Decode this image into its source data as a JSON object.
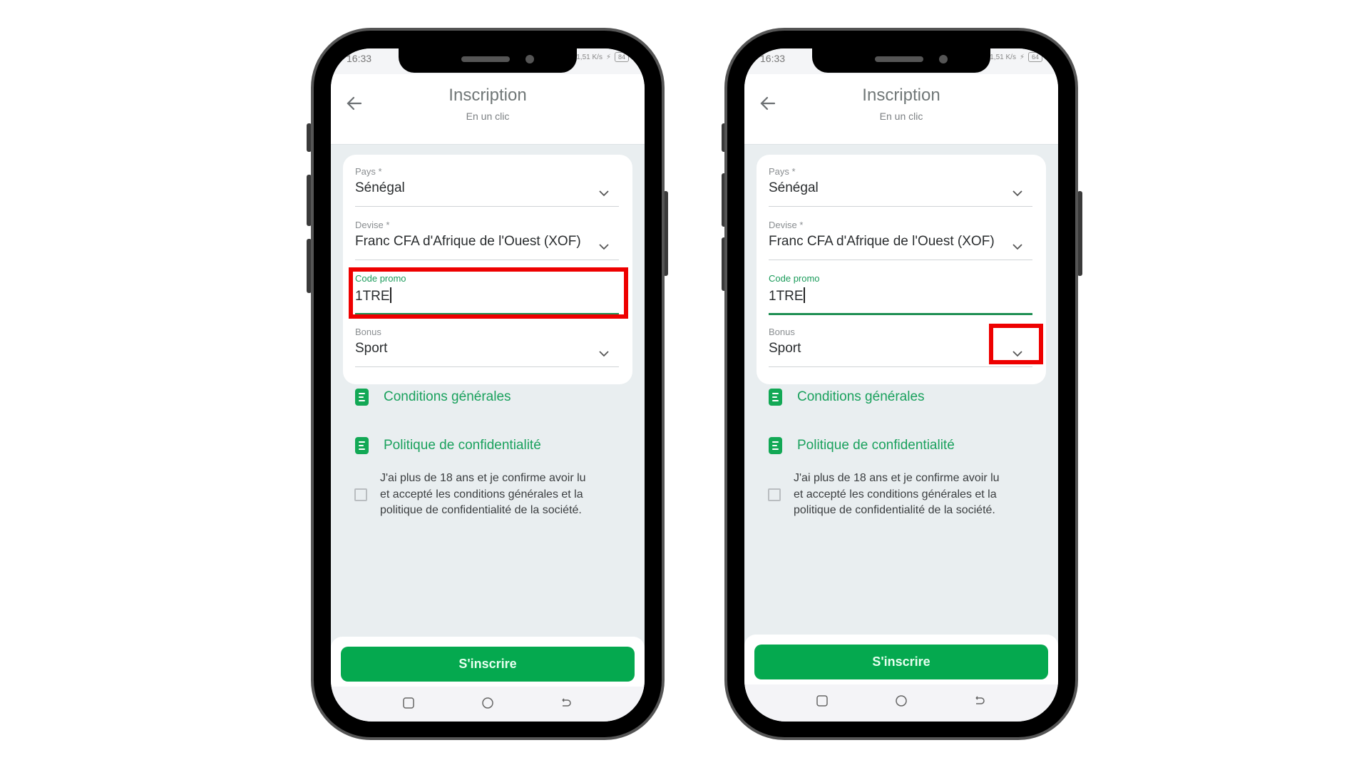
{
  "phones": [
    {
      "status": {
        "time": "16:33",
        "speed": "1,51 K/s",
        "battery": "84"
      },
      "header": {
        "title": "Inscription",
        "subtitle": "En un clic"
      },
      "form": {
        "country": {
          "label": "Pays *",
          "value": "Sénégal"
        },
        "currency": {
          "label": "Devise *",
          "value": "Franc CFA d'Afrique de l'Ouest (XOF)"
        },
        "promo": {
          "label": "Code promo",
          "value": "1TRE"
        },
        "bonus": {
          "label": "Bonus",
          "value": "Sport"
        }
      },
      "links": {
        "terms": "Conditions générales",
        "privacy": "Politique de confidentialité"
      },
      "consent": "J'ai plus de 18 ans et je confirme avoir lu et accepté les conditions générales et la politique de confidentialité de la société.",
      "submit": "S'inscrire",
      "highlight": "promo-code-field"
    },
    {
      "status": {
        "time": "16:33",
        "speed": "1,51 K/s",
        "battery": "64"
      },
      "header": {
        "title": "Inscription",
        "subtitle": "En un clic"
      },
      "form": {
        "country": {
          "label": "Pays *",
          "value": "Sénégal"
        },
        "currency": {
          "label": "Devise *",
          "value": "Franc CFA d'Afrique de l'Ouest (XOF)"
        },
        "promo": {
          "label": "Code promo",
          "value": "1TRE"
        },
        "bonus": {
          "label": "Bonus",
          "value": "Sport"
        }
      },
      "links": {
        "terms": "Conditions générales",
        "privacy": "Politique de confidentialité"
      },
      "consent": "J'ai plus de 18 ans et je confirme avoir lu et accepté les conditions générales et la politique de confidentialité de la société.",
      "submit": "S'inscrire",
      "highlight": "bonus-dropdown-chevron"
    }
  ],
  "colors": {
    "accent": "#05a94f",
    "link": "#1aa15d",
    "highlight": "#ee0000"
  }
}
